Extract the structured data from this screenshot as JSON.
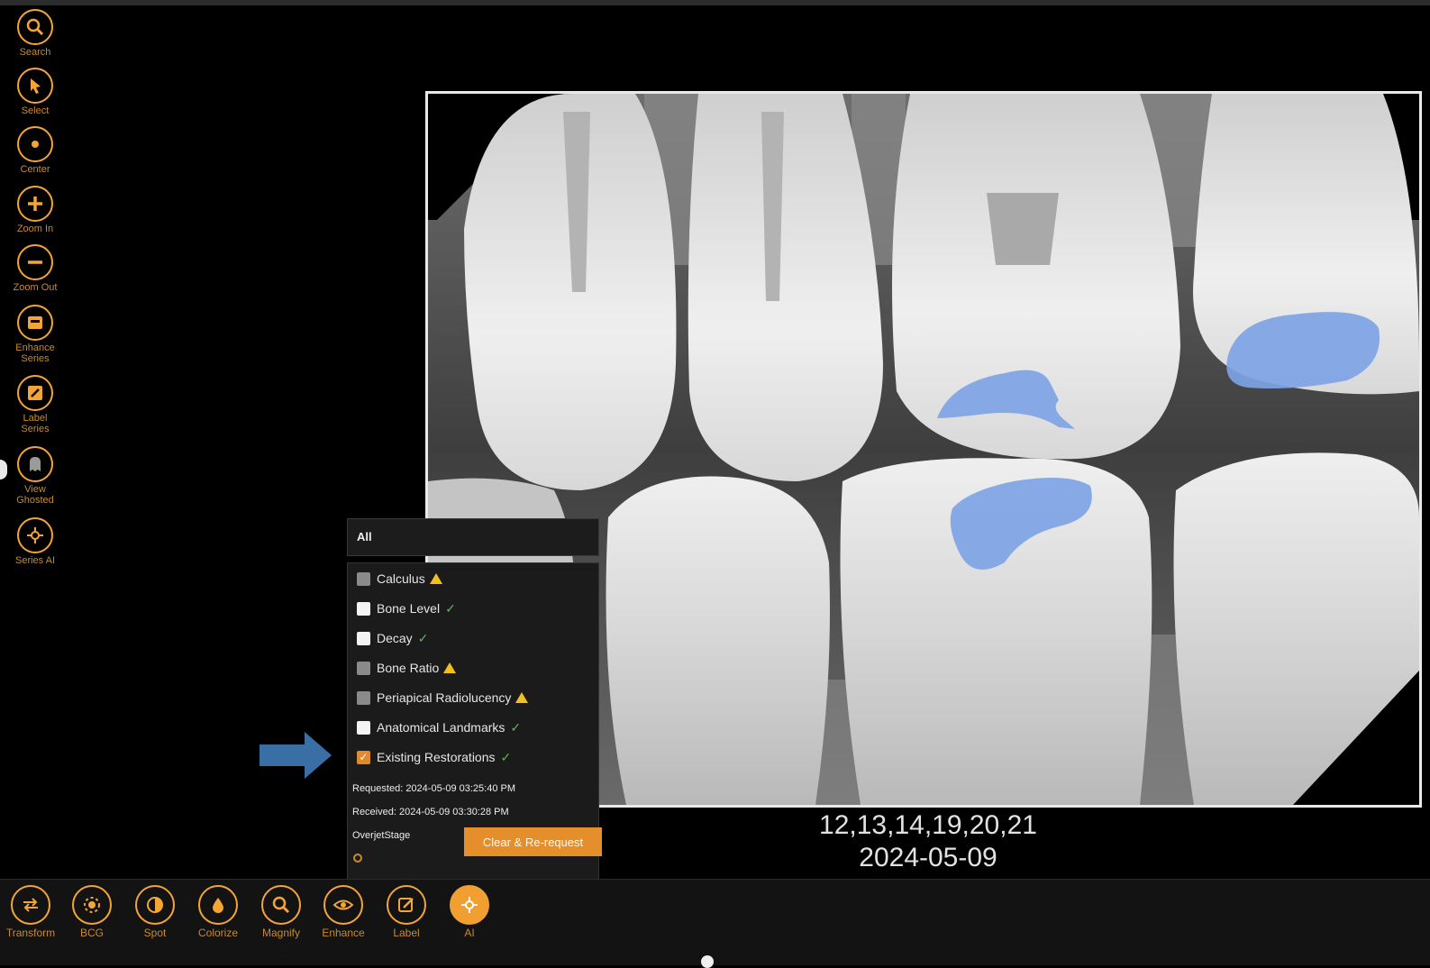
{
  "left_toolbar": {
    "tools": [
      {
        "label": "Search",
        "icon": "search-icon"
      },
      {
        "label": "Select",
        "icon": "cursor-icon"
      },
      {
        "label": "Center",
        "icon": "center-dot-icon"
      },
      {
        "label": "Zoom In",
        "icon": "zoom-in-icon"
      },
      {
        "label": "Zoom Out",
        "icon": "zoom-out-icon"
      },
      {
        "label": "Enhance\nSeries",
        "icon": "enhance-series-icon"
      },
      {
        "label": "Label\nSeries",
        "icon": "label-series-icon"
      },
      {
        "label": "View\nGhosted",
        "icon": "ghost-icon"
      },
      {
        "label": "Series AI",
        "icon": "ai-icon"
      }
    ]
  },
  "viewer": {
    "teeth_label": "12,13,14,19,20,21",
    "date_label": "2024-05-09"
  },
  "ai_panel": {
    "filter_value": "All",
    "findings": [
      {
        "label": "Calculus",
        "checkbox": "grey",
        "status": "warning"
      },
      {
        "label": "Bone Level",
        "checkbox": "white",
        "status": "ok"
      },
      {
        "label": "Decay",
        "checkbox": "white",
        "status": "ok"
      },
      {
        "label": "Bone Ratio",
        "checkbox": "grey",
        "status": "warning"
      },
      {
        "label": "Periapical Radiolucency",
        "checkbox": "grey",
        "status": "warning"
      },
      {
        "label": "Anatomical Landmarks",
        "checkbox": "white",
        "status": "ok"
      },
      {
        "label": "Existing Restorations",
        "checkbox": "checked",
        "status": "ok"
      }
    ],
    "requested": "Requested: 2024-05-09 03:25:40 PM",
    "received": "Received: 2024-05-09 03:30:28 PM",
    "source": "OverjetStage",
    "clear_button": "Clear & Re-request"
  },
  "bottom_toolbar": {
    "tools": [
      {
        "label": "Transform",
        "icon": "transform-icon",
        "active": false
      },
      {
        "label": "BCG",
        "icon": "bcg-icon",
        "active": false
      },
      {
        "label": "Spot",
        "icon": "spot-icon",
        "active": false
      },
      {
        "label": "Colorize",
        "icon": "colorize-icon",
        "active": false
      },
      {
        "label": "Magnify",
        "icon": "magnify-icon",
        "active": false
      },
      {
        "label": "Enhance",
        "icon": "eye-icon",
        "active": false
      },
      {
        "label": "Label",
        "icon": "label-icon",
        "active": false
      },
      {
        "label": "AI",
        "icon": "ai-icon",
        "active": true
      }
    ]
  },
  "colors": {
    "accent": "#f3a536",
    "highlight": "#7ea4e6",
    "ok": "#5db35d",
    "warning": "#f2c01e",
    "callout_arrow": "#3a6fa5"
  }
}
